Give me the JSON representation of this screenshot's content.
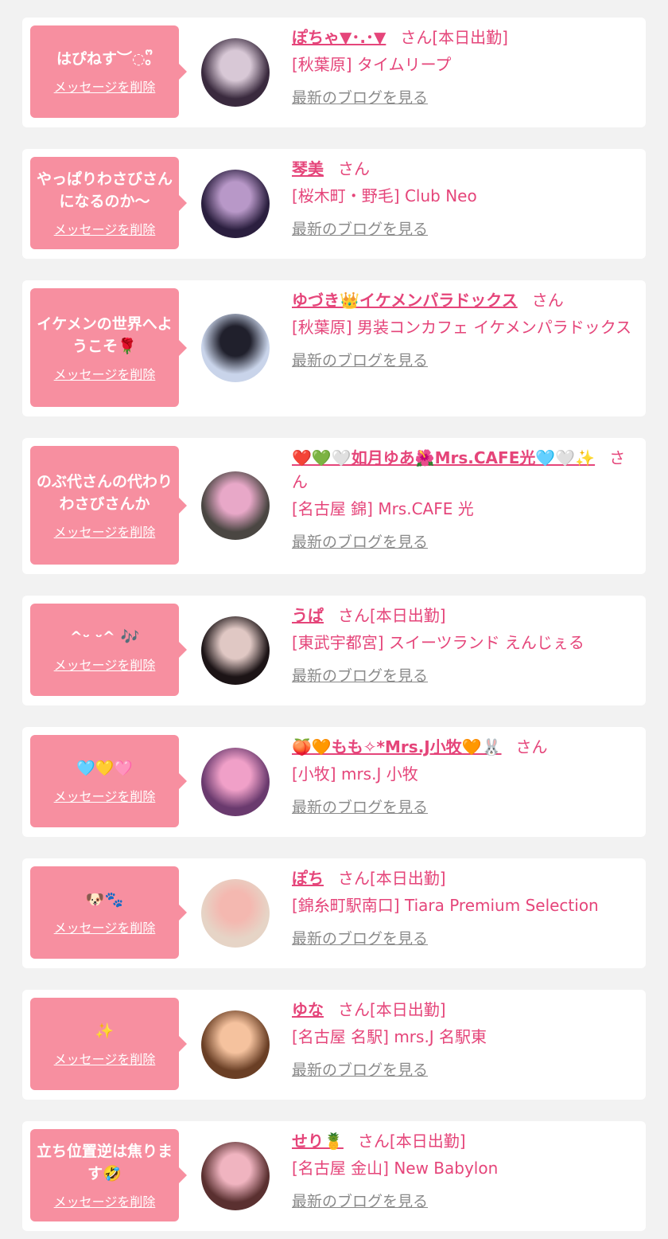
{
  "delete_label": "メッセージを削除",
  "blog_label": "最新のブログを見る",
  "entries": [
    {
      "message": "はぴねす︶◌｡ᩚ",
      "name": "ぽちゃ▼･.･▼",
      "suffix": "さん[本日出勤]",
      "shop": "[秋葉原] タイムリープ",
      "avatar_colors": [
        "#3a2a3e",
        "#d8c8d6"
      ]
    },
    {
      "message": "やっぱりわさびさんになるのか〜",
      "name": "琴美",
      "suffix": "さん",
      "shop": "[桜木町・野毛] Club Neo",
      "avatar_colors": [
        "#2b1f3f",
        "#b898c8"
      ]
    },
    {
      "message": "イケメンの世界へようこそ🌹",
      "name": "ゆづき👑イケメンパラドックス",
      "suffix": "さん",
      "shop": "[秋葉原] 男装コンカフェ イケメンパラドックス",
      "avatar_colors": [
        "#c9d4ea",
        "#20202c"
      ]
    },
    {
      "message": "のぶ代さんの代わりわさびさんか",
      "name": "❤️💚🤍如月ゆあ🌺Mrs.CAFE光🩵🤍✨",
      "suffix": "さん",
      "shop": "[名古屋 錦] Mrs.CAFE 光",
      "avatar_colors": [
        "#4a4642",
        "#e8a8c8"
      ]
    },
    {
      "message": "^ᵕ ᵕ^ 🎶",
      "name": "うぱ",
      "suffix": "さん[本日出勤]",
      "shop": "[東武宇都宮] スイーツランド えんじぇる",
      "avatar_colors": [
        "#1c1416",
        "#e0c8c4"
      ]
    },
    {
      "message": "🩵💛🩷",
      "name": "🍑🧡もも✧*Mrs.J小牧🧡🐰",
      "suffix": "さん",
      "shop": "[小牧] mrs.J 小牧",
      "avatar_colors": [
        "#6a3a6e",
        "#f0a0c8"
      ]
    },
    {
      "message": "🐶🐾",
      "name": "ぽち",
      "suffix": "さん[本日出勤]",
      "shop": "[錦糸町駅南口] Tiara Premium Selection",
      "avatar_colors": [
        "#e6d4c6",
        "#f4b8b0"
      ]
    },
    {
      "message": "✨",
      "name": "ゆな",
      "suffix": "さん[本日出勤]",
      "shop": "[名古屋 名駅] mrs.J 名駅東",
      "avatar_colors": [
        "#6a3f25",
        "#f5c29e"
      ]
    },
    {
      "message": "立ち位置逆は焦ります🤣",
      "name": "せり🍍",
      "suffix": "さん[本日出勤]",
      "shop": "[名古屋 金山] New Babylon",
      "avatar_colors": [
        "#5a3030",
        "#f0b4c0"
      ]
    }
  ]
}
